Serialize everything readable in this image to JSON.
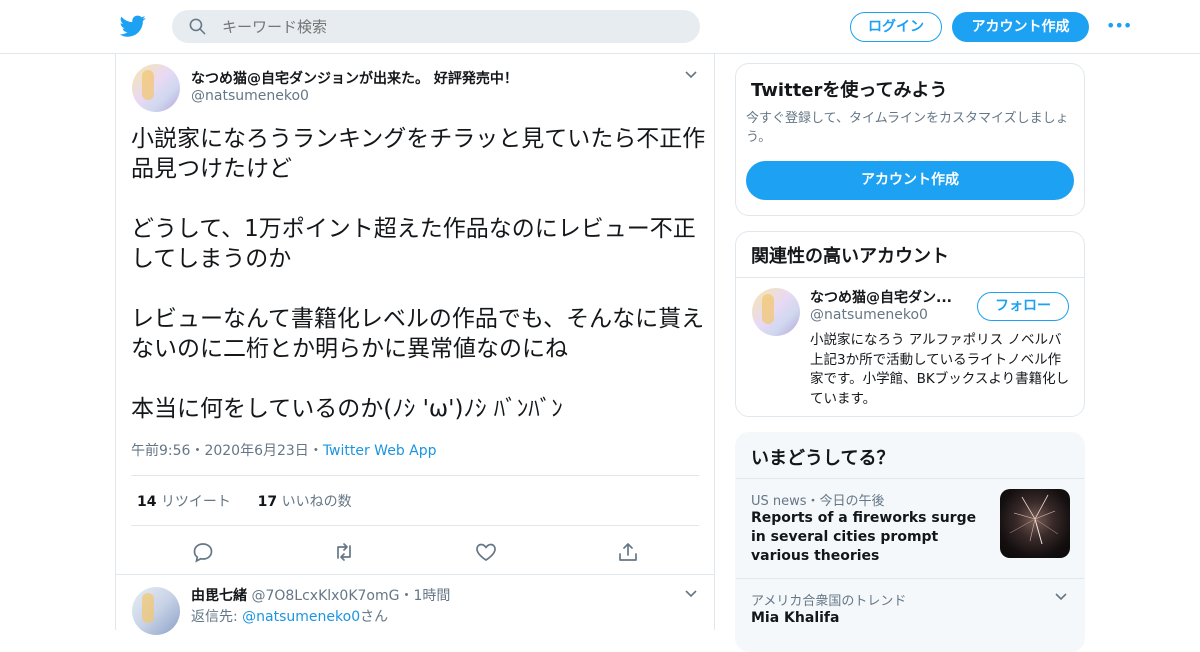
{
  "header": {
    "search_placeholder": "キーワード検索",
    "login_label": "ログイン",
    "signup_label": "アカウント作成",
    "more_label": "•••",
    "brand_color": "#1da1f2"
  },
  "tweet": {
    "author_name": "なつめ猫@自宅ダンジョンが出来た。 好評発売中！",
    "author_handle": "@natsumeneko0",
    "paragraphs": [
      "小説家になろうランキングをチラッと見ていたら不正作品見つけたけど",
      "どうして、1万ポイント超えた作品なのにレビュー不正してしまうのか",
      "レビューなんて書籍化レベルの作品でも、そんなに貰えないのに二桁とか明らかに異常値なのにね",
      "本当に何をしているのか(ﾉｼ 'ω')ﾉｼ ﾊﾞﾝﾊﾞﾝ"
    ],
    "time": "午前9:56",
    "date": "2020年6月23日",
    "dot": "・",
    "app": "Twitter Web App",
    "retweet_count": "14",
    "retweet_label": "リツイート",
    "like_count": "17",
    "like_label": "いいねの数"
  },
  "reply": {
    "name": "由毘七緒",
    "handle": "@7O8LcxKlx0K7omG",
    "time": "1時間",
    "dot": "・",
    "reply_prefix": "返信先: ",
    "reply_mention": "@natsumeneko0",
    "reply_suffix": "さん"
  },
  "sidebar": {
    "try_card": {
      "title": "Twitterを使ってみよう",
      "desc": "今すぐ登録して、タイムラインをカスタマイズしましょう。",
      "button": "アカウント作成"
    },
    "related_card": {
      "title": "関連性の高いアカウント",
      "name": "なつめ猫@自宅ダン...",
      "handle": "@natsumeneko0",
      "follow_label": "フォロー",
      "bio": "小説家になろう アルファポリス ノベルバ 上記3か所で活動しているライトノベル作家です。小学館、BKブックスより書籍化しています。"
    },
    "trends_card": {
      "title": "いまどうしてる？",
      "item1_context": "US news・今日の午後",
      "item1_title": "Reports of a fireworks surge in several cities prompt various theories",
      "item2_context": "アメリカ合衆国のトレンド",
      "item2_title": "Mia Khalifa"
    }
  }
}
